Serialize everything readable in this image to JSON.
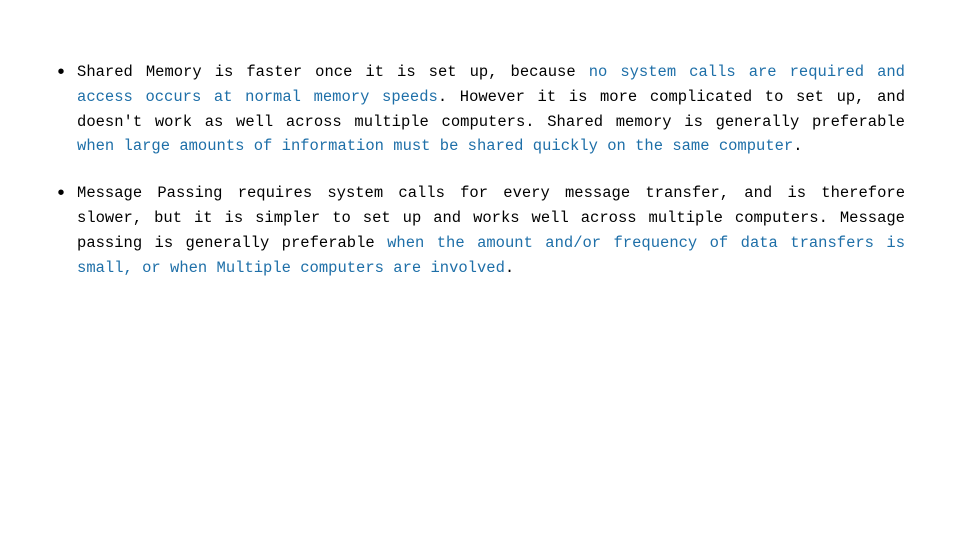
{
  "slide": {
    "bullets": [
      {
        "id": "bullet-shared-memory",
        "parts": [
          {
            "text": "Shared Memory is faster once it is set up, because ",
            "blue": false
          },
          {
            "text": "no system calls are required and access occurs at normal memory speeds",
            "blue": true
          },
          {
            "text": ". However it is more complicated to set up, and doesn't work as well across multiple computers. Shared memory is generally preferable ",
            "blue": false
          },
          {
            "text": "when large amounts of information must be shared quickly on the same computer",
            "blue": true
          },
          {
            "text": ".",
            "blue": false
          }
        ]
      },
      {
        "id": "bullet-message-passing",
        "parts": [
          {
            "text": "Message Passing requires system calls for every message transfer, and is therefore slower, but it is simpler to set up and works well across multiple computers. Message passing is generally preferable ",
            "blue": false
          },
          {
            "text": "when the amount and/or frequency of data transfers is small, or when Multiple computers are involved",
            "blue": true
          },
          {
            "text": ".",
            "blue": false
          }
        ]
      }
    ]
  }
}
